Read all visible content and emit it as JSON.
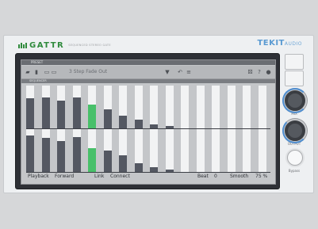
{
  "header": {
    "brand": "GATTR",
    "brand_sub": "SEQUENCED STEREO GATE",
    "vendor": "TEKIT",
    "vendor_suffix": "AUDIO"
  },
  "panel": {
    "strip_title": "PRESET",
    "preset_name": "3 Step Fade Out",
    "steps_title": "SEQUENCER"
  },
  "toolbar_icons": [
    "folder-icon",
    "save-icon",
    "copy-icon",
    "paste-icon",
    "dropdown-arrow-icon",
    "undo-icon",
    "redo-icon",
    "randomize-icon",
    "settings-icon",
    "help-icon"
  ],
  "sequencer": {
    "steps": 16,
    "active_step": 4,
    "colors": {
      "bar": "#545862",
      "active": "#48c06a",
      "off": "#f2f3f4"
    },
    "top_row": [
      0.7,
      0.72,
      0.65,
      0.72,
      0.55,
      0.45,
      0.3,
      0.2,
      0.1,
      0.05,
      0,
      0,
      0,
      0,
      0,
      0
    ],
    "bottom_row": [
      0.85,
      0.8,
      0.72,
      0.82,
      0.55,
      0.5,
      0.38,
      0.2,
      0.12,
      0.06,
      0,
      0,
      0,
      0,
      0,
      0
    ]
  },
  "status": {
    "playback_label": "Playback",
    "playback_value": "Forward",
    "link_label": "Link",
    "link_value": "Connect",
    "beat_label": "Beat",
    "beat_value": "0",
    "smooth_label": "Smooth",
    "smooth_value": "75 %"
  },
  "side": {
    "knob1_label": "MIX",
    "knob2_label": "OUTPUT",
    "bypass_label": "Bypass"
  }
}
